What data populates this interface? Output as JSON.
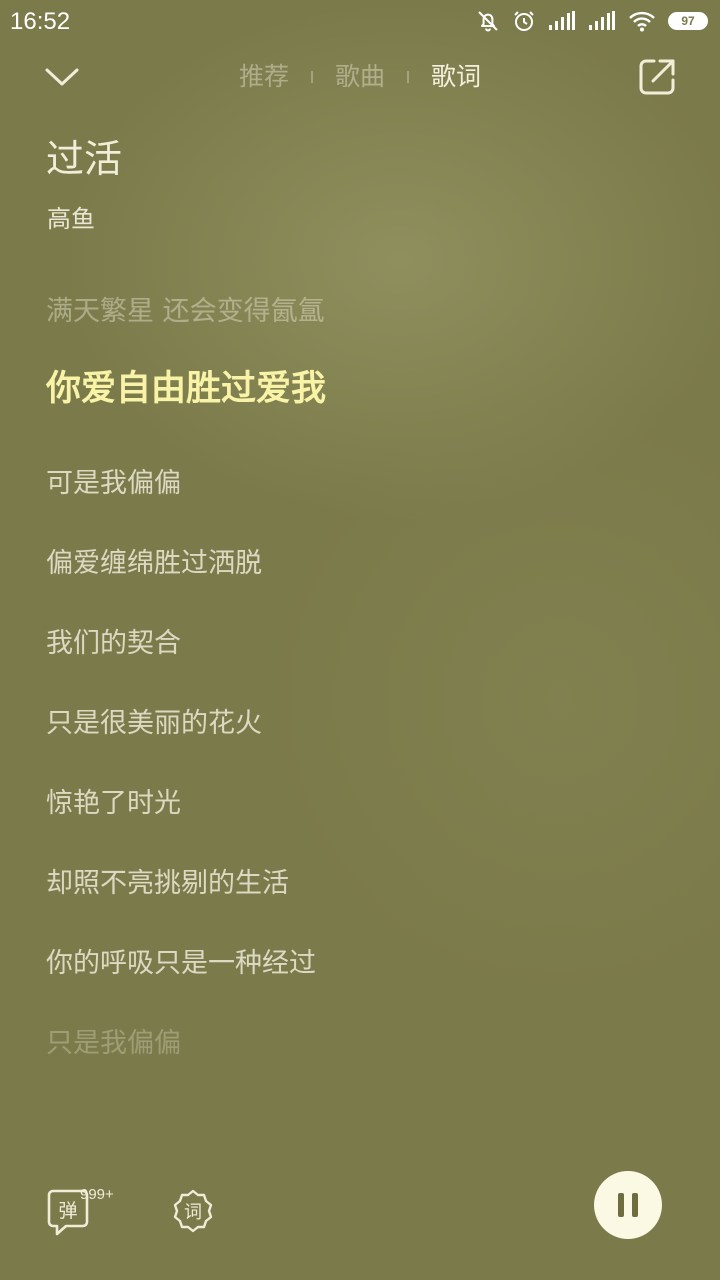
{
  "status_bar": {
    "time": "16:52",
    "battery": "97",
    "icons": [
      "mute-bell-icon",
      "alarm-icon",
      "signal-icon",
      "signal-icon",
      "wifi-icon",
      "battery-icon"
    ]
  },
  "nav": {
    "collapse_icon": "chevron-down-icon",
    "tabs": [
      {
        "label": "推荐",
        "active": false
      },
      {
        "label": "歌曲",
        "active": false
      },
      {
        "label": "歌词",
        "active": true
      }
    ],
    "share_icon": "share-external-icon"
  },
  "song": {
    "title": "过活",
    "artist": "高鱼"
  },
  "lyrics": {
    "lines": [
      "满天繁星 还会变得氤氲",
      "你爱自由胜过爱我",
      "可是我偏偏",
      "偏爱缠绵胜过洒脱",
      "我们的契合",
      "只是很美丽的花火",
      "惊艳了时光",
      "却照不亮挑剔的生活",
      "你的呼吸只是一种经过",
      "只是我偏偏"
    ],
    "current_index": 1
  },
  "controls": {
    "danmaku_label": "弹",
    "danmaku_count": "999+",
    "lyric_label": "词",
    "pause_icon": "pause-icon"
  },
  "colors": {
    "background": "#7b7a4a",
    "current_lyric": "#f9f3a8",
    "button_fill": "#fbf8e4"
  }
}
